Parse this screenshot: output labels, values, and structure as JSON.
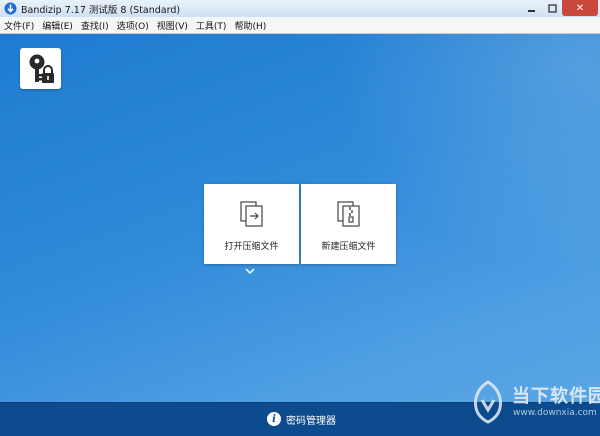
{
  "window": {
    "title": "Bandizip 7.17 测试版 8 (Standard)",
    "close_label": "✕",
    "colors": {
      "background": "#2f86d4",
      "bottom_bar": "#0d4b8f",
      "close_button": "#c9483c"
    }
  },
  "menu": [
    "文件(F)",
    "编辑(E)",
    "查找(I)",
    "选项(O)",
    "视图(V)",
    "工具(T)",
    "帮助(H)"
  ],
  "actions": {
    "open_label": "打开压缩文件",
    "new_label": "新建压缩文件"
  },
  "bottom": {
    "password_manager_label": "密码管理器"
  },
  "watermark": {
    "brand": "当下软件园",
    "url": "www.downxia.com"
  },
  "icons": {
    "app": "bandizip-app-icon",
    "key": "key-lock-icon",
    "open": "open-archive-icon",
    "new": "new-archive-icon",
    "chevron": "chevron-down-icon",
    "info": "info-icon"
  }
}
